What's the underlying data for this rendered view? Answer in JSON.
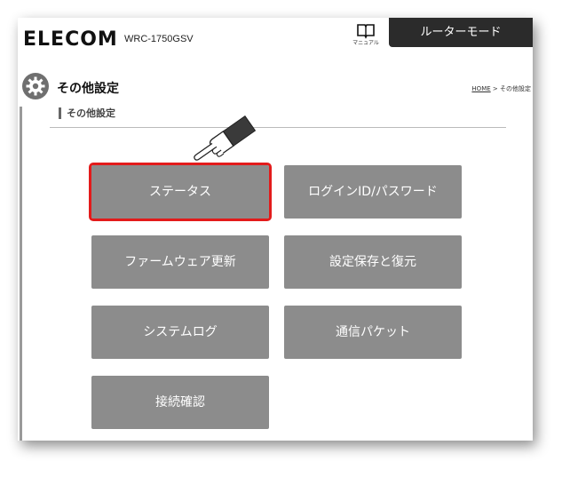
{
  "header": {
    "brand": "ELECOM",
    "model": "WRC-1750GSV",
    "manual_label": "マニュアル",
    "mode_tab": "ルーターモード"
  },
  "page": {
    "title": "その他設定",
    "breadcrumb_home": "HOME",
    "breadcrumb_sep": " > ",
    "breadcrumb_current": "その他設定",
    "section_heading": "その他設定"
  },
  "menu": {
    "buttons": [
      {
        "label": "ステータス",
        "highlighted": true
      },
      {
        "label": "ログインID/パスワード"
      },
      {
        "label": "ファームウェア更新"
      },
      {
        "label": "設定保存と復元"
      },
      {
        "label": "システムログ"
      },
      {
        "label": "通信パケット"
      },
      {
        "label": "接続確認"
      }
    ]
  },
  "colors": {
    "button_bg": "#8c8c8c",
    "highlight": "#e31b1b",
    "tab_bg": "#2b2b2b"
  }
}
